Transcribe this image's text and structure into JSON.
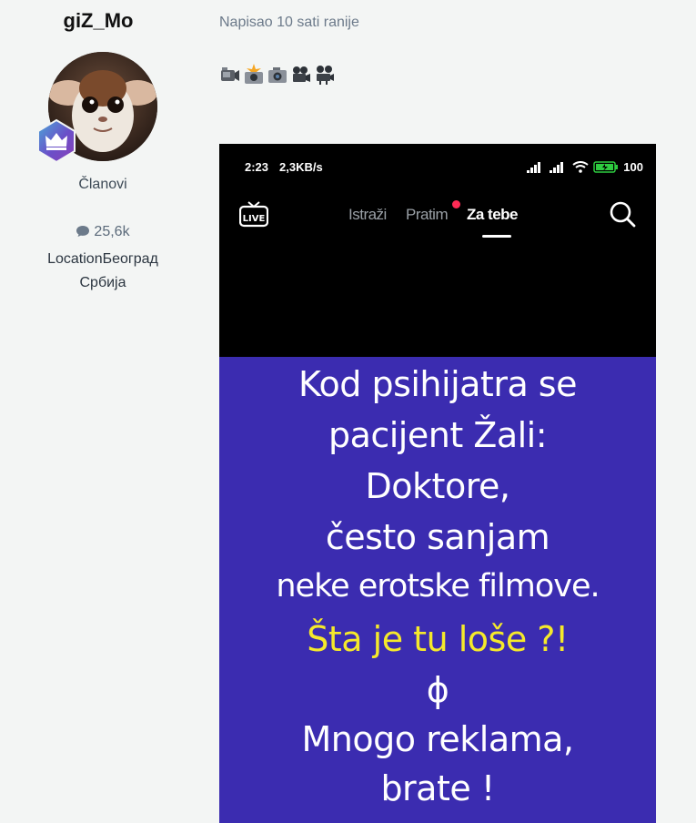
{
  "author": {
    "username": "giZ_Mo",
    "group": "Članovi",
    "post_count": "25,6k",
    "location": "LocationБеоград Србија",
    "location_line1": "LocationБеоград",
    "location_line2": "Србија",
    "icons": {
      "badge": "crown-badge-icon",
      "posts": "speech-bubble-icon"
    }
  },
  "post": {
    "time": "Napisao 10 sati ranije",
    "emoji": [
      "video-camera-icon",
      "camera-flash-icon",
      "camera-icon",
      "movie-camera-icon",
      "film-projector-icon"
    ]
  },
  "phone": {
    "status": {
      "time": "2:23",
      "speed": "2,3KB/s",
      "battery": "100"
    },
    "nav": {
      "tabs": [
        {
          "label": "Istraži",
          "active": false
        },
        {
          "label": "Pratim",
          "active": false,
          "notification_dot": true
        },
        {
          "label": "Za tebe",
          "active": true
        }
      ],
      "icons": [
        "live-icon",
        "search-icon"
      ]
    },
    "meme": {
      "lines": [
        "Kod psihijatra se",
        "pacijent Žali:",
        "Doktore,",
        "često sanjam",
        "neke erotske filmove.",
        "Šta je tu loše ?!",
        "ϕ",
        "Mnogo reklama,",
        "brate !"
      ],
      "colors": {
        "background": "#3b2cb0",
        "text": "#ffffff",
        "highlight": "#f5e92b"
      }
    }
  }
}
